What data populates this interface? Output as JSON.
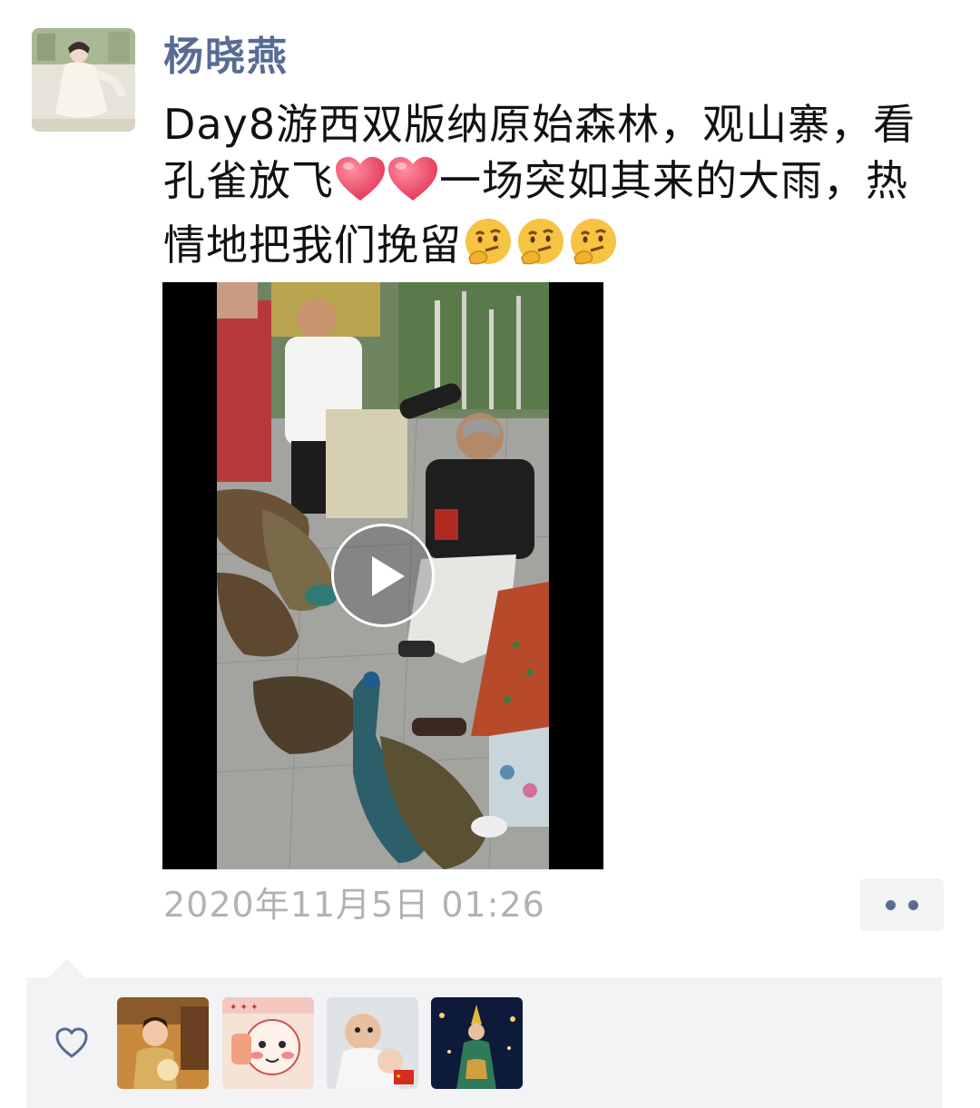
{
  "post": {
    "author": "杨晓燕",
    "text_line1": "Day8游西双版纳原始森林，观山寨，看",
    "text_line2_a": "孔雀放飞",
    "text_line2_b": "一场突如其来的大雨，热",
    "text_line3": "情地把我们挽留",
    "text_emojis": [
      "heart-emoji",
      "heart-emoji",
      "thinking-face-emoji",
      "thinking-face-emoji",
      "thinking-face-emoji"
    ],
    "timestamp": "2020年11月5日 01:26"
  },
  "video": {
    "play_icon": "play-icon"
  },
  "likes": {
    "icon": "heart-outline-icon",
    "avatars": [
      "liker-avatar-1",
      "liker-avatar-2",
      "liker-avatar-3",
      "liker-avatar-4"
    ]
  },
  "colors": {
    "author_name": "#576b95",
    "timestamp": "#b2b2b2",
    "likes_bg": "#f3f3f5",
    "heart_emoji": "#e9425f",
    "thinking_emoji": "#f6c343"
  }
}
